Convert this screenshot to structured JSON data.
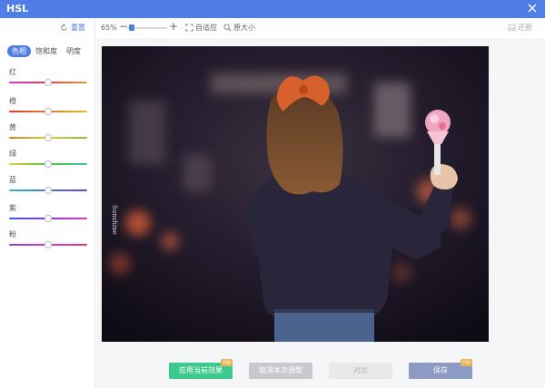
{
  "window": {
    "title": "HSL"
  },
  "sidebar": {
    "reset_label": "重置",
    "tabs": [
      {
        "label": "色相",
        "active": true
      },
      {
        "label": "饱和度",
        "active": false
      },
      {
        "label": "明度",
        "active": false
      }
    ],
    "sliders": [
      {
        "label": "红",
        "value": 0.5,
        "gradient": [
          "#c63de0",
          "#e0403a",
          "#e0a035"
        ]
      },
      {
        "label": "橙",
        "value": 0.5,
        "gradient": [
          "#d83a38",
          "#e07a2a",
          "#e0c030"
        ]
      },
      {
        "label": "黄",
        "value": 0.5,
        "gradient": [
          "#e07a2a",
          "#e0d030",
          "#7ac43a"
        ]
      },
      {
        "label": "绿",
        "value": 0.5,
        "gradient": [
          "#e0d030",
          "#4ec43a",
          "#36c4b0"
        ]
      },
      {
        "label": "蓝",
        "value": 0.5,
        "gradient": [
          "#36c4b0",
          "#3a7ae0",
          "#7a3ae0"
        ]
      },
      {
        "label": "紫",
        "value": 0.5,
        "gradient": [
          "#3a5ae0",
          "#8a3ae0",
          "#d63ad0"
        ]
      },
      {
        "label": "粉",
        "value": 0.5,
        "gradient": [
          "#8a3ae0",
          "#d63ad0",
          "#e03a6a"
        ]
      }
    ]
  },
  "toolbar": {
    "zoom": "65%",
    "zoom_minus": "−",
    "zoom_plus": "+",
    "fit_label": "自适应",
    "original_label": "原大小",
    "restore_label": "还原"
  },
  "photo": {
    "watermark": "Sunshine"
  },
  "actions": {
    "apply_label": "应用当前效果",
    "apply_badge": "vip",
    "cancel_label": "取消本次调整",
    "compare_label": "对比",
    "save_label": "保存",
    "save_badge": "vip"
  },
  "colors": {
    "accent": "#4e7ee6",
    "apply": "#3ec98e",
    "save": "#8c9ac4",
    "vip": "#e8b456"
  }
}
